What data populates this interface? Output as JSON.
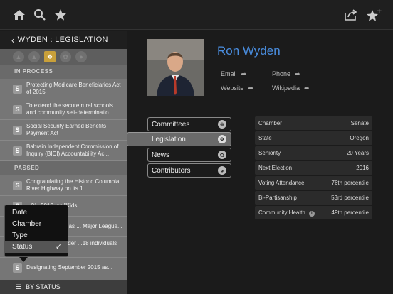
{
  "header": {
    "back_label": "WYDEN : LEGISLATION"
  },
  "colors": {
    "accent": "#4a8ee0",
    "filter_active": "#c9a03a"
  },
  "legislation": {
    "in_process_label": "IN PROCESS",
    "passed_label": "PASSED",
    "in_process": [
      {
        "title": "Protecting Medicare Beneficiaries Act of 2015"
      },
      {
        "title": "To extend the secure rural schools and community self-determinatio..."
      },
      {
        "title": "Social Security Earned Benefits Payment Act"
      },
      {
        "title": "Bahrain Independent Commission of Inquiry (BICI) Accountability Ac..."
      }
    ],
    "passed": [
      {
        "title": "Congratulating the Historic Columbia River Highway on its 1..."
      },
      {
        "title": "...21, 2016, as \"Kids ..."
      },
      {
        "title": "...rtland Timbers as ... Major League..."
      },
      {
        "title": "...senseless murder ...18 individuals (s..."
      },
      {
        "title": "Designating September 2015 as..."
      }
    ],
    "sort_label": "BY STATUS"
  },
  "sort_menu": {
    "options": [
      "Date",
      "Chamber",
      "Type",
      "Status"
    ],
    "selected": "Status"
  },
  "profile": {
    "name": "Ron Wyden",
    "links": {
      "email": "Email",
      "phone": "Phone",
      "website": "Website",
      "wikipedia": "Wikipedia"
    }
  },
  "nav": {
    "committees": "Committees",
    "legislation": "Legislation",
    "news": "News",
    "contributors": "Contributors"
  },
  "stats": [
    {
      "label": "Chamber",
      "value": "Senate"
    },
    {
      "label": "State",
      "value": "Oregon"
    },
    {
      "label": "Seniority",
      "value": "20 Years"
    },
    {
      "label": "Next Election",
      "value": "2016"
    },
    {
      "label": "Voting Attendance",
      "value": "76th percentile"
    },
    {
      "label": "Bi-Partisanship",
      "value": "53rd percentile"
    },
    {
      "label": "Community Health",
      "value": "49th percentile"
    }
  ]
}
